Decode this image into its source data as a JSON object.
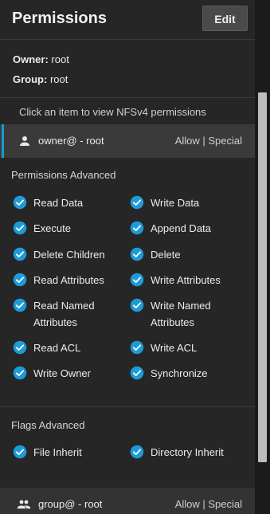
{
  "header": {
    "title": "Permissions",
    "edit_label": "Edit"
  },
  "meta": {
    "owner_label": "Owner:",
    "owner_value": "root",
    "group_label": "Group:",
    "group_value": "root"
  },
  "hint": "Click an item to view NFSv4 permissions",
  "aces": [
    {
      "who": "owner@ - root",
      "type": "Allow | Special",
      "icon": "user-icon"
    },
    {
      "who": "group@ - root",
      "type": "Allow | Special",
      "icon": "group-icon"
    }
  ],
  "permissions_advanced": {
    "title": "Permissions Advanced",
    "items": [
      "Read Data",
      "Write Data",
      "Execute",
      "Append Data",
      "Delete Children",
      "Delete",
      "Read Attributes",
      "Write Attributes",
      "Read Named Attributes",
      "Write Named Attributes",
      "Read ACL",
      "Write ACL",
      "Write Owner",
      "Synchronize"
    ]
  },
  "flags_advanced": {
    "title": "Flags Advanced",
    "items": [
      "File Inherit",
      "Directory Inherit"
    ]
  },
  "colors": {
    "accent": "#1e9bd7",
    "background": "#262626",
    "selected_row": "#3a3a3a"
  }
}
